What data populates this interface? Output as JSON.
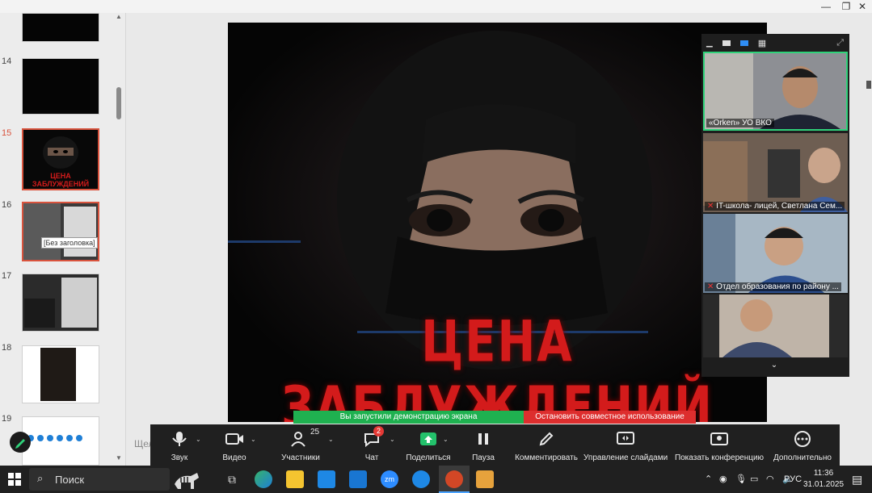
{
  "slides_panel": {
    "items": [
      {
        "number": "14",
        "selected": false
      },
      {
        "number": "15",
        "selected": true,
        "title": "ЦЕНА ЗАБЛУЖДЕНИЙ"
      },
      {
        "number": "16",
        "selected": false,
        "tooltip": "[Без заголовка]"
      },
      {
        "number": "17",
        "selected": false
      },
      {
        "number": "18",
        "selected": false
      },
      {
        "number": "19",
        "selected": false
      }
    ]
  },
  "slide": {
    "title": "ЦЕНА ЗАБЛУЖДЕНИЙ",
    "notes_placeholder": "Щел"
  },
  "participants": [
    {
      "name": "«Orken» УО ВКО",
      "active": true,
      "muted": false
    },
    {
      "name": "IT-школа- лицей, Светлана Сем...",
      "active": false,
      "muted": true
    },
    {
      "name": "Отдел образования по району ...",
      "active": false,
      "muted": true
    },
    {
      "name": "",
      "active": false,
      "muted": false
    }
  ],
  "share_banner": {
    "text": "Вы запустили демонстрацию экрана",
    "stop": "Остановить совместное использование"
  },
  "toolbar": {
    "audio": "Звук",
    "video": "Видео",
    "participants": "Участники",
    "participants_count": "25",
    "chat": "Чат",
    "chat_badge": "2",
    "share": "Поделиться",
    "pause": "Пауза",
    "annotate": "Комментировать",
    "slide_control": "Управление слайдами",
    "show_conference": "Показать конференцию",
    "more": "Дополнительно"
  },
  "taskbar": {
    "search_label": "Поиск",
    "language": "РУС",
    "time": "11:36",
    "date": "31.01.2025"
  },
  "colors": {
    "accent_red": "#d31b1b",
    "share_green": "#1fb150",
    "stop_red": "#dd2e2e",
    "selected_border": "#d9533d"
  }
}
